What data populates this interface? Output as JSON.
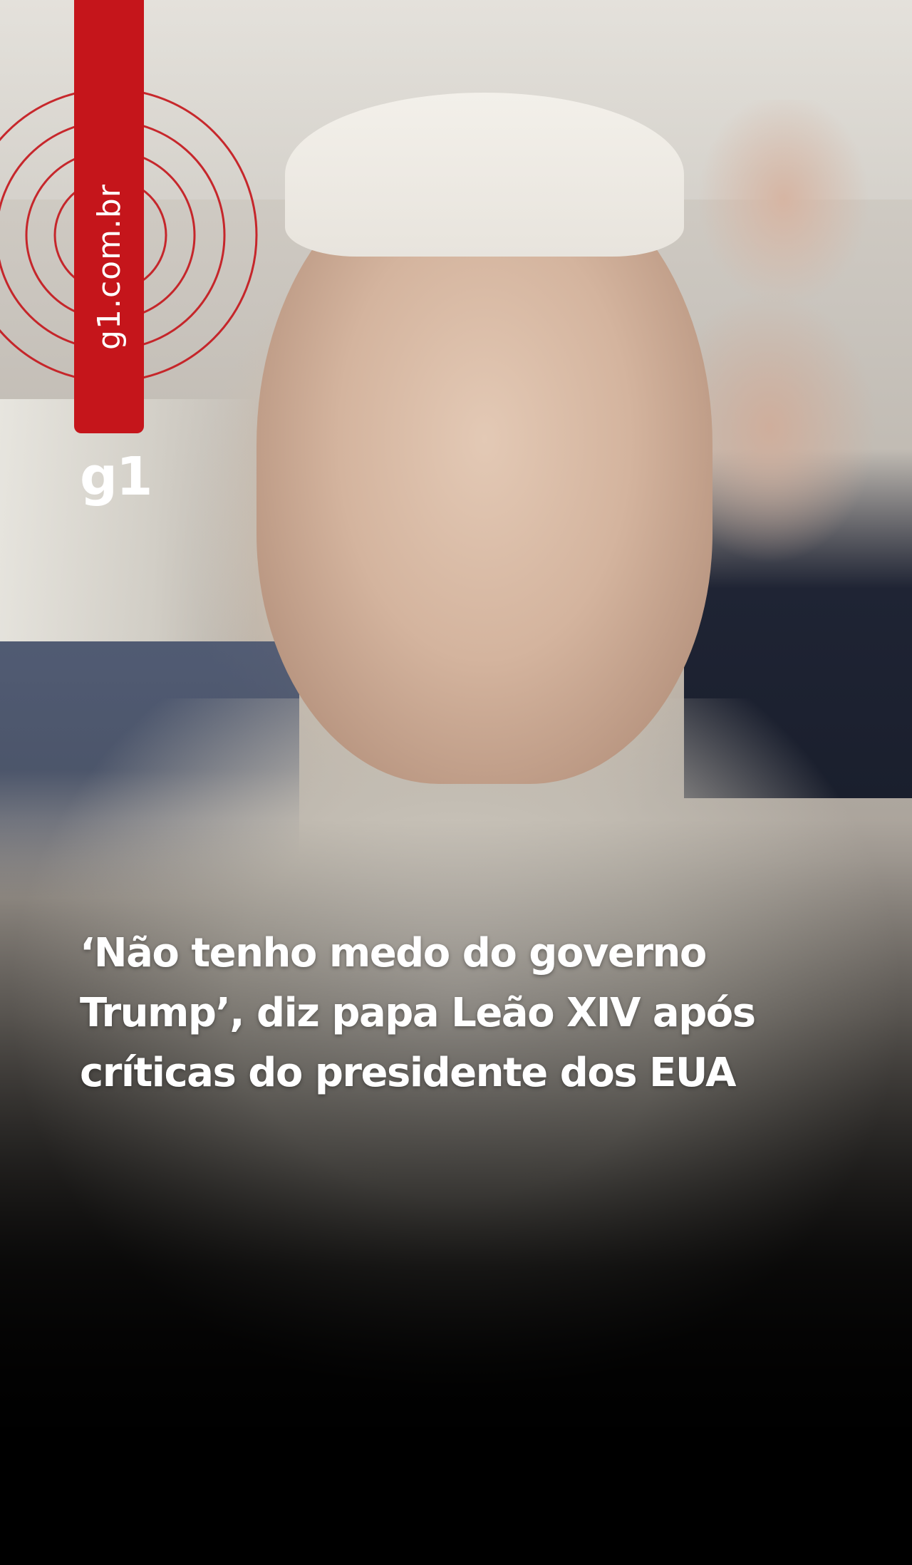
{
  "brand": {
    "site_label": "g1.com.br",
    "logo_text": "g1",
    "accent_color": "#c5151b"
  },
  "icons": {
    "radar": "concentric-circles-icon"
  },
  "headline": {
    "lines": [
      "‘Não tenho medo do governo",
      "Trump’, diz papa Leão XIV após",
      "críticas do presidente dos EUA"
    ]
  }
}
